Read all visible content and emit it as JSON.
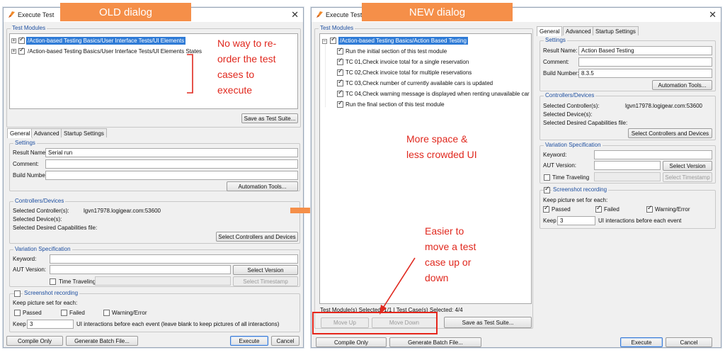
{
  "old": {
    "callout": "OLD dialog",
    "title": "Execute Test",
    "test_modules_legend": "Test Modules",
    "tree": [
      "/Action-based Testing Basics/User Interface Tests/UI Elements",
      "/Action-based Testing Basics/User Interface Tests/UI Elements States"
    ],
    "save_suite": "Save as Test Suite...",
    "tabs": [
      "General",
      "Advanced",
      "Startup Settings"
    ],
    "settings_legend": "Settings",
    "result_name_label": "Result Name:",
    "result_name_value": "Serial run",
    "comment_label": "Comment:",
    "build_number_label": "Build Number:",
    "automation_tools": "Automation Tools...",
    "controllers_legend": "Controllers/Devices",
    "selected_controllers_label": "Selected Controller(s):",
    "selected_controllers_value": "lgvn17978.logigear.com:53600",
    "selected_devices_label": "Selected Device(s):",
    "selected_caps_label": "Selected Desired Capabilities file:",
    "select_controllers": "Select Controllers and Devices",
    "variation_legend": "Variation Specification",
    "keyword_label": "Keyword:",
    "aut_version_label": "AUT Version:",
    "select_version": "Select Version",
    "time_traveling": "Time Traveling",
    "select_timestamp": "Select Timestamp",
    "screenshot_legend": "Screenshot recording",
    "keep_picture_label": "Keep picture set for each:",
    "passed": "Passed",
    "failed": "Failed",
    "warning_error": "Warning/Error",
    "keep_label": "Keep",
    "keep_value": "3",
    "keep_suffix": "UI interactions before each event (leave blank to keep pictures of all interactions)",
    "compile_only": "Compile Only",
    "generate_batch": "Generate Batch File...",
    "execute": "Execute",
    "cancel": "Cancel"
  },
  "new": {
    "callout": "NEW dialog",
    "title": "Execute Test",
    "test_modules_legend": "Test Modules",
    "root": "/Action-based Testing Basics/Action Based Testing",
    "cases": [
      "Run the initial section of this test module",
      "TC 01,Check invoice total for a single reservation",
      "TC 02,Check invoice total for multiple reservations",
      "TC 03,Check number of currently available cars is updated",
      "TC 04,Check warning message is displayed when renting unavailable car",
      "Run the final section of this test module"
    ],
    "status": "Test Module(s) Selected: 1/1  |  Test Case(s) Selected: 4/4",
    "move_up": "Move Up",
    "move_down": "Move Down",
    "save_suite": "Save as Test Suite...",
    "tabs": [
      "General",
      "Advanced",
      "Startup Settings"
    ],
    "settings_legend": "Settings",
    "result_name_label": "Result Name:",
    "result_name_value": "Action Based Testing",
    "comment_label": "Comment:",
    "build_number_label": "Build Number:",
    "build_number_value": "8.3.5",
    "automation_tools": "Automation Tools...",
    "controllers_legend": "Controllers/Devices",
    "selected_controllers_label": "Selected Controller(s):",
    "selected_controllers_value": "lgvn17978.logigear.com:53600",
    "selected_devices_label": "Selected Device(s):",
    "selected_caps_label": "Selected Desired Capabilities file:",
    "select_controllers": "Select Controllers and Devices",
    "variation_legend": "Variation Specification",
    "keyword_label": "Keyword:",
    "aut_version_label": "AUT Version:",
    "select_version": "Select Version",
    "time_traveling": "Time Traveling",
    "select_timestamp": "Select Timestamp",
    "screenshot_legend": "Screenshot recording",
    "keep_picture_label": "Keep picture set for each:",
    "passed": "Passed",
    "failed": "Failed",
    "warning_error": "Warning/Error",
    "keep_label": "Keep",
    "keep_value": "3",
    "keep_suffix": "UI interactions before each event",
    "compile_only": "Compile Only",
    "generate_batch": "Generate Batch File...",
    "execute": "Execute",
    "cancel": "Cancel"
  },
  "annotations": {
    "reorder_lines": [
      "No way to re-",
      "order the test",
      "cases to",
      "execute"
    ],
    "space_lines": [
      "More space &",
      "less crowded UI"
    ],
    "move_lines": [
      "Easier to",
      "move a test",
      "case up or",
      "down"
    ]
  },
  "colors": {
    "callout": "#f58f49",
    "annotation": "#e0281e",
    "selection": "#2f7bd6",
    "arrow": "#f58f49"
  }
}
